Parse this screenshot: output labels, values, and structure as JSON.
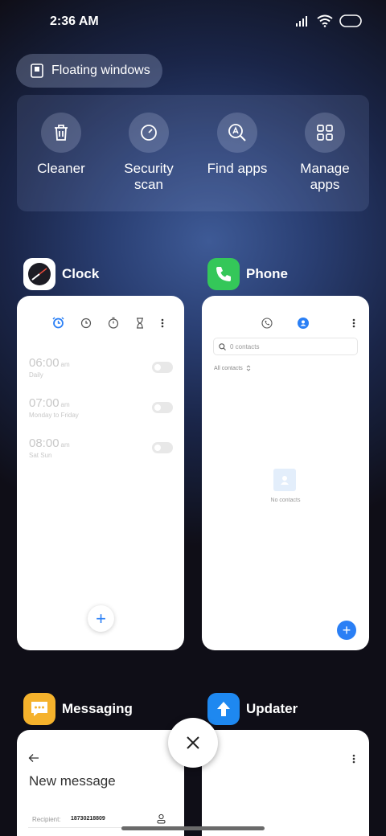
{
  "status_bar": {
    "time": "2:36 AM"
  },
  "floating_windows": {
    "label": "Floating windows"
  },
  "tools": [
    {
      "label": "Cleaner",
      "icon": "trash-icon"
    },
    {
      "label": "Security scan",
      "icon": "speedometer-icon"
    },
    {
      "label": "Find apps",
      "icon": "find-apps-icon"
    },
    {
      "label": "Manage apps",
      "icon": "grid-icon"
    }
  ],
  "recents": {
    "clock": {
      "title": "Clock",
      "alarms": [
        {
          "time": "06:00",
          "ampm": "am",
          "repeat": "Daily"
        },
        {
          "time": "07:00",
          "ampm": "am",
          "repeat": "Monday to Friday"
        },
        {
          "time": "08:00",
          "ampm": "am",
          "repeat": "Sat Sun"
        }
      ],
      "add_symbol": "+"
    },
    "phone": {
      "title": "Phone",
      "search_placeholder": "0 contacts",
      "filter": "All contacts",
      "empty_text": "No contacts",
      "add_symbol": "+"
    },
    "messaging": {
      "title": "Messaging",
      "heading": "New message",
      "recipient_label": "Recipient:",
      "recipient_value": "18730218809"
    },
    "updater": {
      "title": "Updater"
    }
  },
  "colors": {
    "accent": "#2a7ff5",
    "phone_green": "#34c759",
    "messaging_yellow": "#f5b22c",
    "updater_blue": "#1e88f0"
  }
}
